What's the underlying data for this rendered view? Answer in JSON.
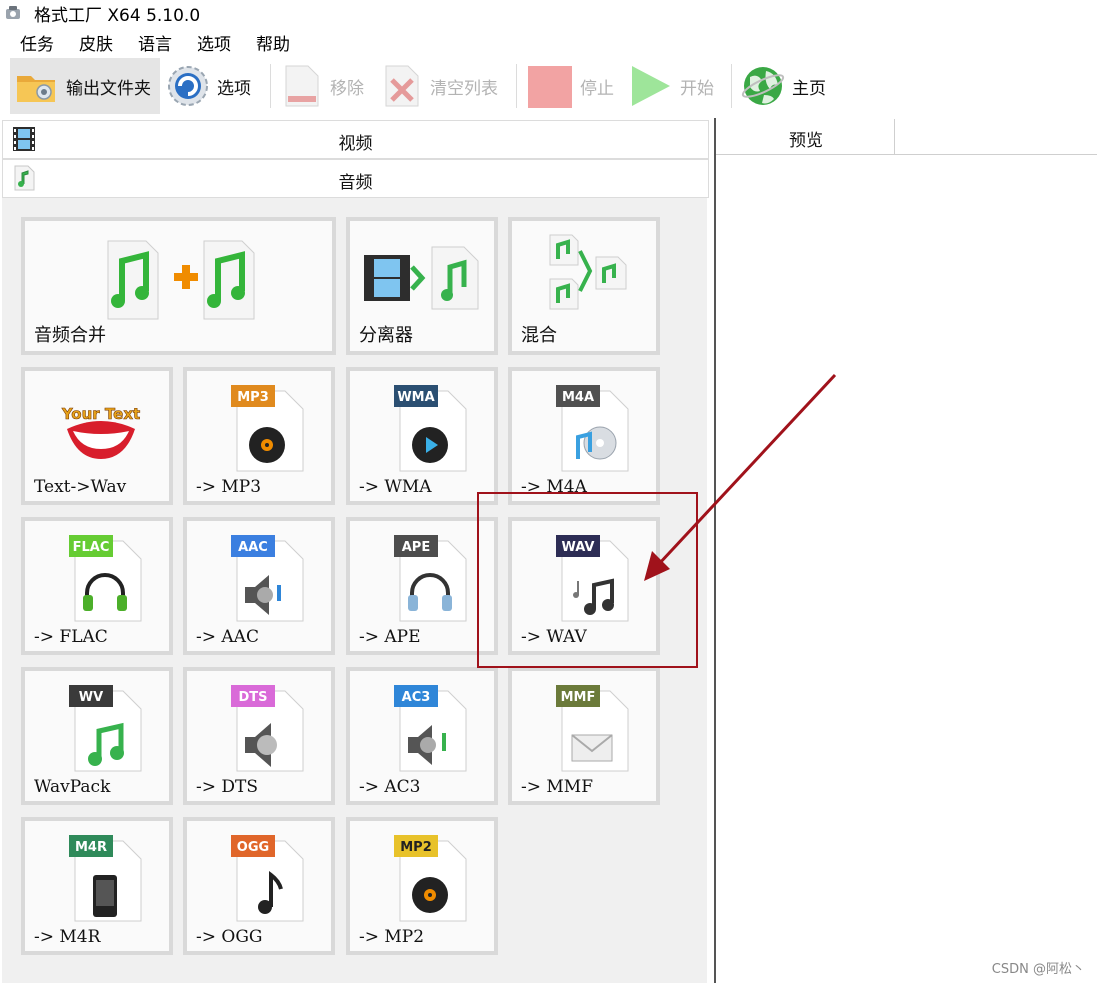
{
  "window": {
    "title": "格式工厂 X64 5.10.0"
  },
  "menu": [
    {
      "label": "任务"
    },
    {
      "label": "皮肤"
    },
    {
      "label": "语言"
    },
    {
      "label": "选项"
    },
    {
      "label": "帮助"
    }
  ],
  "toolbar": {
    "output_folder": "输出文件夹",
    "options": "选项",
    "remove": "移除",
    "clear_list": "清空列表",
    "stop": "停止",
    "start": "开始",
    "home": "主页"
  },
  "categories": {
    "video": "视频",
    "audio": "音频"
  },
  "tiles": [
    {
      "label": "音频合并"
    },
    {
      "label": "分离器"
    },
    {
      "label": "混合"
    },
    {
      "label": "Text->Wav",
      "badge": "Your Text"
    },
    {
      "label": "-> MP3",
      "badge": "MP3",
      "badge_color": "#e08a1e"
    },
    {
      "label": "-> WMA",
      "badge": "WMA",
      "badge_color": "#2b4f72"
    },
    {
      "label": "-> M4A",
      "badge": "M4A",
      "badge_color": "#505050"
    },
    {
      "label": "-> FLAC",
      "badge": "FLAC",
      "badge_color": "#66cc33"
    },
    {
      "label": "-> AAC",
      "badge": "AAC",
      "badge_color": "#3b7fe0"
    },
    {
      "label": "-> APE",
      "badge": "APE",
      "badge_color": "#4d4d4d"
    },
    {
      "label": "-> WAV",
      "badge": "WAV",
      "badge_color": "#2d2d55"
    },
    {
      "label": "WavPack",
      "badge": "WV",
      "badge_color": "#3a3a3a"
    },
    {
      "label": "-> DTS",
      "badge": "DTS",
      "badge_color": "#d96ad8"
    },
    {
      "label": "-> AC3",
      "badge": "AC3",
      "badge_color": "#2f86d8"
    },
    {
      "label": "-> MMF",
      "badge": "MMF",
      "badge_color": "#6b7a3a"
    },
    {
      "label": "-> M4R",
      "badge": "M4R",
      "badge_color": "#2f8a5a"
    },
    {
      "label": "-> OGG",
      "badge": "OGG",
      "badge_color": "#e0662a"
    },
    {
      "label": "-> MP2",
      "badge": "MP2",
      "badge_color": "#e8c22a"
    }
  ],
  "preview": {
    "header": "预览"
  },
  "watermark": "CSDN @阿松丶",
  "colors": {
    "annotation": "#a0121b"
  }
}
